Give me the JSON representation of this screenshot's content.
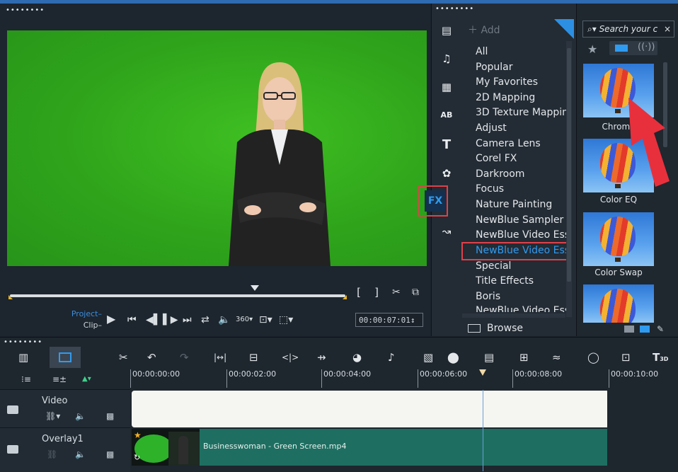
{
  "preview": {
    "project_label": "Project–",
    "clip_label": "Clip–",
    "timecode": "00:00:07:01↕",
    "mark_in": "[",
    "mark_out": "]"
  },
  "library": {
    "add_label": "Add",
    "categories": [
      "All",
      "Popular",
      "My Favorites",
      "2D Mapping",
      "3D Texture Mappin",
      "Adjust",
      "Camera Lens",
      "Corel FX",
      "Darkroom",
      "Focus",
      "Nature Painting",
      "NewBlue Sampler",
      "NewBlue Video Ess",
      "NewBlue Video Ess",
      "Special",
      "Title Effects",
      "Boris",
      "NewBlue Video Ess"
    ],
    "selected_index": 13,
    "fx_label": "FX",
    "browse_label": "Browse"
  },
  "effects": {
    "search_placeholder": "Search your c",
    "items": [
      "Chroma",
      "Color EQ",
      "Color Swap"
    ]
  },
  "timeline": {
    "ruler": [
      "00:00:00:00",
      "00:00:02:00",
      "00:00:04:00",
      "00:00:06:00",
      "00:00:08:00",
      "00:00:10:00"
    ],
    "tracks": [
      {
        "name": "Video"
      },
      {
        "name": "Overlay1"
      }
    ],
    "overlay_clip": "Businesswoman - Green Screen.mp4"
  },
  "colors": {
    "accent": "#2f9bf0",
    "highlight_box": "#e0404a",
    "chroma_green": "#2fa51b",
    "overlay_clip": "#1e6f61"
  }
}
